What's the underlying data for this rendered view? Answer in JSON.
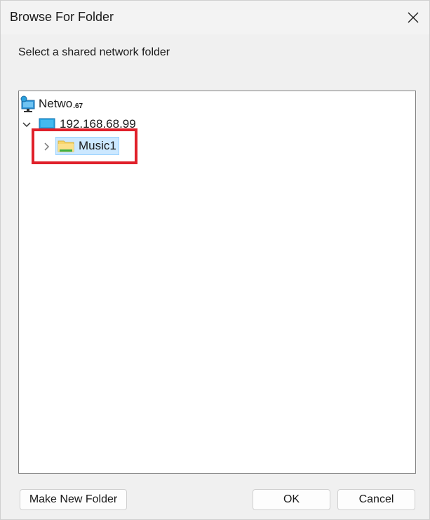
{
  "window": {
    "title": "Browse For Folder",
    "close_icon": "close-icon"
  },
  "instruction": "Select a shared network folder",
  "tree": {
    "network": {
      "label": "Netwo",
      "suffix": ".67",
      "icon": "network-icon"
    },
    "host": {
      "label": "192.168.68.99",
      "expanded": true,
      "icon": "computer-icon"
    },
    "folder": {
      "label": "Music1",
      "selected": true,
      "expanded": false,
      "icon": "folder-icon"
    }
  },
  "buttons": {
    "make_new_folder": "Make New Folder",
    "ok": "OK",
    "cancel": "Cancel"
  },
  "colors": {
    "selection": "#cce8ff",
    "highlight_annotation": "#e0202a"
  }
}
